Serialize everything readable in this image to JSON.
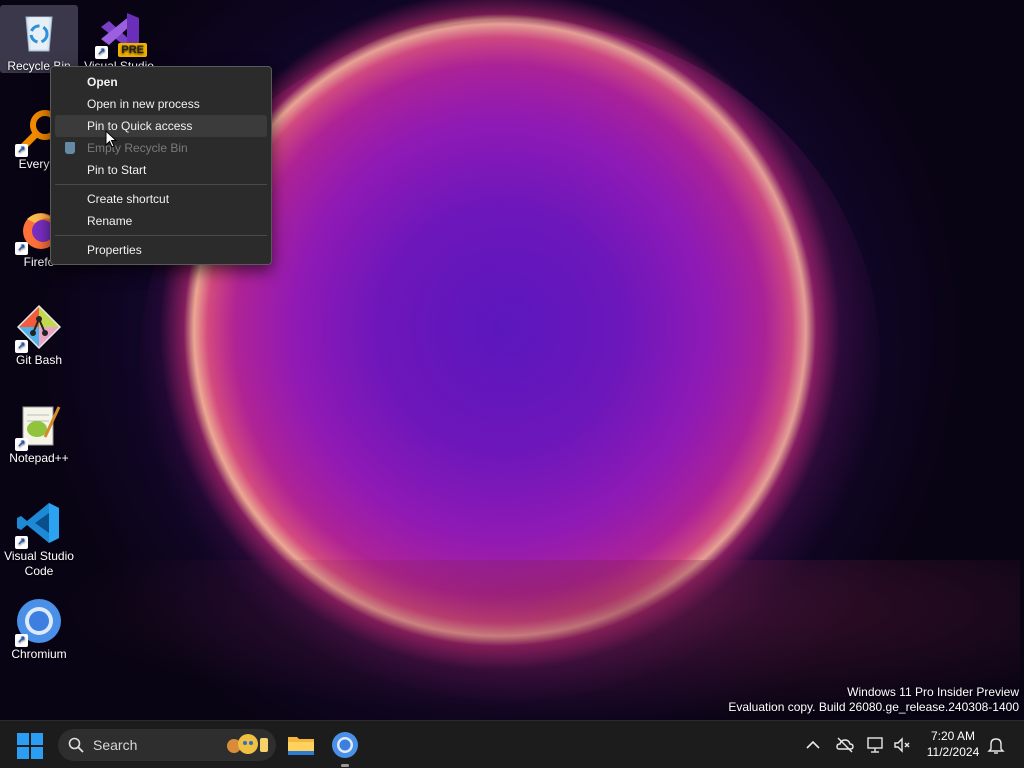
{
  "desktop": {
    "icons": [
      {
        "label": "Recycle Bin"
      },
      {
        "label": "Visual Studio",
        "badge": "PRE"
      },
      {
        "label": "Everyth"
      },
      {
        "label": "Firefo"
      },
      {
        "label": "Git Bash"
      },
      {
        "label": "Notepad++"
      },
      {
        "label": "Visual Studio Code"
      },
      {
        "label": "Chromium"
      }
    ]
  },
  "context_menu": {
    "items": [
      {
        "label": "Open"
      },
      {
        "label": "Open in new process"
      },
      {
        "label": "Pin to Quick access"
      },
      {
        "label": "Empty Recycle Bin"
      },
      {
        "label": "Pin to Start"
      },
      {
        "label": "Create shortcut"
      },
      {
        "label": "Rename"
      },
      {
        "label": "Properties"
      }
    ]
  },
  "watermark": {
    "line1": "Windows 11 Pro Insider Preview",
    "line2": "Evaluation copy. Build 26080.ge_release.240308-1400"
  },
  "taskbar": {
    "search_label": "Search",
    "apps": [
      "file-explorer",
      "chromium"
    ],
    "clock": {
      "time": "7:20 AM",
      "date": "11/2/2024"
    }
  },
  "colors": {
    "accent": "#2b9df2",
    "menu_bg": "#2b2b2b",
    "taskbar_bg": "#1c1c1c"
  }
}
